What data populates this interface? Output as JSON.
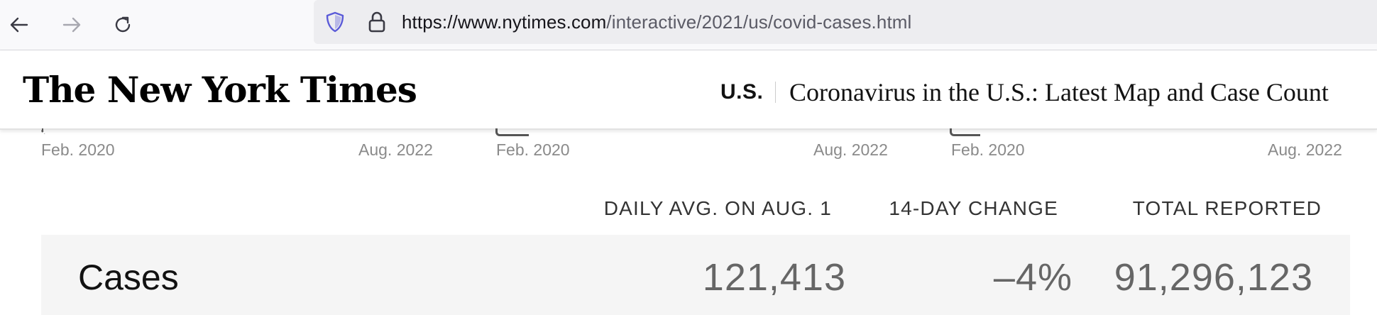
{
  "browser": {
    "url_host": "https://www.nytimes.com",
    "url_path": "/interactive/2021/us/covid-cases.html",
    "icons": [
      "back-icon",
      "forward-icon",
      "reload-icon",
      "shield-icon",
      "lock-icon"
    ]
  },
  "header": {
    "logo": "The New York Times",
    "section": "U.S.",
    "headline": "Coronavirus in the U.S.: Latest Map and Case Count"
  },
  "charts": {
    "axis_labels": [
      {
        "start": "Feb. 2020",
        "end": "Aug. 2022"
      },
      {
        "start": "Feb. 2020",
        "end": "Aug. 2022"
      },
      {
        "start": "Feb. 2020",
        "end": "Aug. 2022"
      }
    ]
  },
  "table": {
    "columns": [
      "DAILY AVG. ON AUG. 1",
      "14-DAY CHANGE",
      "TOTAL REPORTED"
    ],
    "rows": [
      {
        "label": "Cases",
        "daily_avg": "121,413",
        "change": "–4%",
        "total": "91,296,123"
      }
    ]
  },
  "colors": {
    "toolbar_bg": "#f9f9fb",
    "urlbar_bg": "#ededf0",
    "shield": "#5a5ad8",
    "row_bg": "#f5f5f5"
  }
}
